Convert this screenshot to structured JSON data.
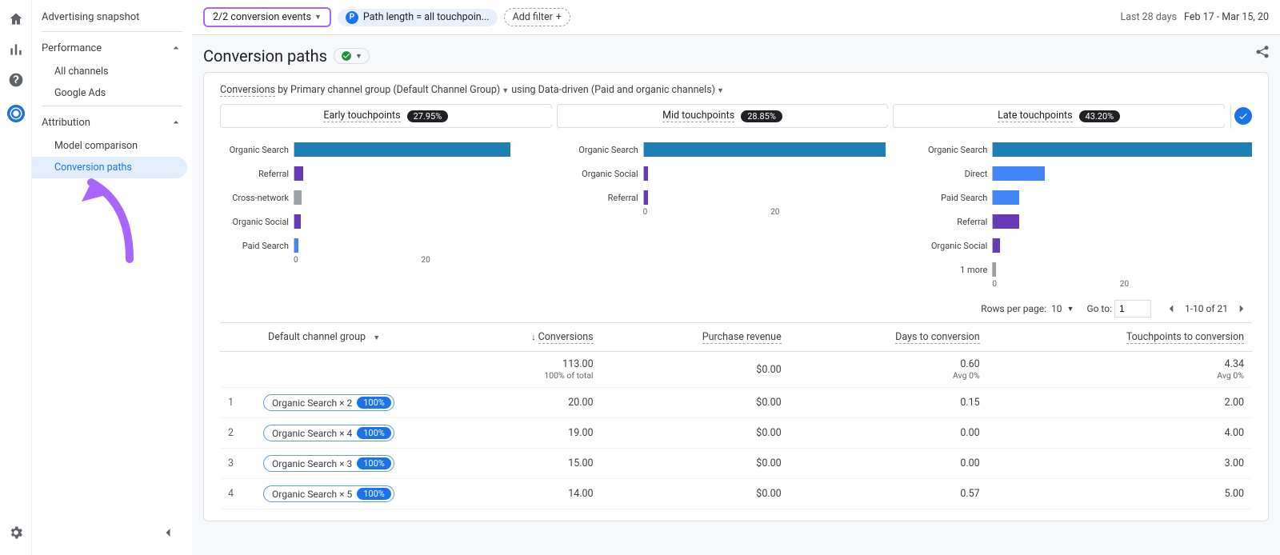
{
  "sidebar": {
    "items": [
      {
        "label": "Advertising snapshot"
      },
      {
        "label": "Performance",
        "children": [
          "All channels",
          "Google Ads"
        ]
      },
      {
        "label": "Attribution",
        "children": [
          "Model comparison",
          "Conversion paths"
        ]
      }
    ],
    "active": "Conversion paths"
  },
  "filterbar": {
    "events_chip": "2/2 conversion events",
    "pathlen_chip": "Path length = all touchpoin...",
    "addfilter": "Add filter",
    "date_label": "Last 28 days",
    "date_range": "Feb 17 - Mar 15, 20"
  },
  "title": "Conversion paths",
  "dimension_row": {
    "lead": "Conversions",
    "mid": " by Primary channel group (Default Channel Group)",
    "tail": " using Data-driven (Paid and organic channels)"
  },
  "touch_tabs": [
    {
      "label": "Early touchpoints",
      "pct": "27.95%"
    },
    {
      "label": "Mid touchpoints",
      "pct": "28.85%"
    },
    {
      "label": "Late touchpoints",
      "pct": "43.20%"
    }
  ],
  "chart_data": [
    {
      "type": "bar",
      "title": "Early touchpoints",
      "xlabel": "",
      "ylabel": "",
      "xlim": [
        0,
        30
      ],
      "categories": [
        "Organic Search",
        "Referral",
        "Cross-network",
        "Organic Social",
        "Paid Search"
      ],
      "series": [
        {
          "name": "credit",
          "values": [
            25.0,
            1.0,
            0.8,
            0.7,
            0.5
          ],
          "colors": [
            "#1f7eb2",
            "#673ab7",
            "#9aa0a6",
            "#673ab7",
            "#4285f4"
          ]
        }
      ]
    },
    {
      "type": "bar",
      "title": "Mid touchpoints",
      "xlabel": "",
      "ylabel": "",
      "xlim": [
        0,
        30
      ],
      "categories": [
        "Organic Search",
        "Organic Social",
        "Referral"
      ],
      "series": [
        {
          "name": "credit",
          "values": [
            28.0,
            0.5,
            0.5
          ],
          "colors": [
            "#1f7eb2",
            "#673ab7",
            "#673ab7"
          ]
        }
      ]
    },
    {
      "type": "bar",
      "title": "Late touchpoints",
      "xlabel": "",
      "ylabel": "",
      "xlim": [
        0,
        30
      ],
      "categories": [
        "Organic Search",
        "Direct",
        "Paid Search",
        "Referral",
        "Organic Social",
        "1 more"
      ],
      "series": [
        {
          "name": "credit",
          "values": [
            30.0,
            6.0,
            3.0,
            3.0,
            0.8,
            0.3
          ],
          "colors": [
            "#1f7eb2",
            "#4285f4",
            "#4285f4",
            "#673ab7",
            "#673ab7",
            "#9aa0a6"
          ]
        }
      ]
    }
  ],
  "table": {
    "rows_per_page_label": "Rows per page:",
    "rows_per_page": "10",
    "goto_label": "Go to:",
    "goto_value": "1",
    "pager_text": "1-10 of 21",
    "group_header": "Default channel group",
    "headers": [
      "Conversions",
      "Purchase revenue",
      "Days to conversion",
      "Touchpoints to conversion"
    ],
    "summary": {
      "conversions": "113.00",
      "conversions_sub": "100% of total",
      "revenue": "$0.00",
      "days": "0.60",
      "days_sub": "Avg 0%",
      "touch": "4.34",
      "touch_sub": "Avg 0%"
    },
    "rows": [
      {
        "n": "1",
        "path": "Organic Search × 2",
        "pct": "100%",
        "c": "20.00",
        "r": "$0.00",
        "d": "0.15",
        "t": "2.00"
      },
      {
        "n": "2",
        "path": "Organic Search × 4",
        "pct": "100%",
        "c": "19.00",
        "r": "$0.00",
        "d": "0.00",
        "t": "4.00"
      },
      {
        "n": "3",
        "path": "Organic Search × 3",
        "pct": "100%",
        "c": "15.00",
        "r": "$0.00",
        "d": "0.00",
        "t": "3.00"
      },
      {
        "n": "4",
        "path": "Organic Search × 5",
        "pct": "100%",
        "c": "14.00",
        "r": "$0.00",
        "d": "0.57",
        "t": "5.00"
      }
    ]
  }
}
